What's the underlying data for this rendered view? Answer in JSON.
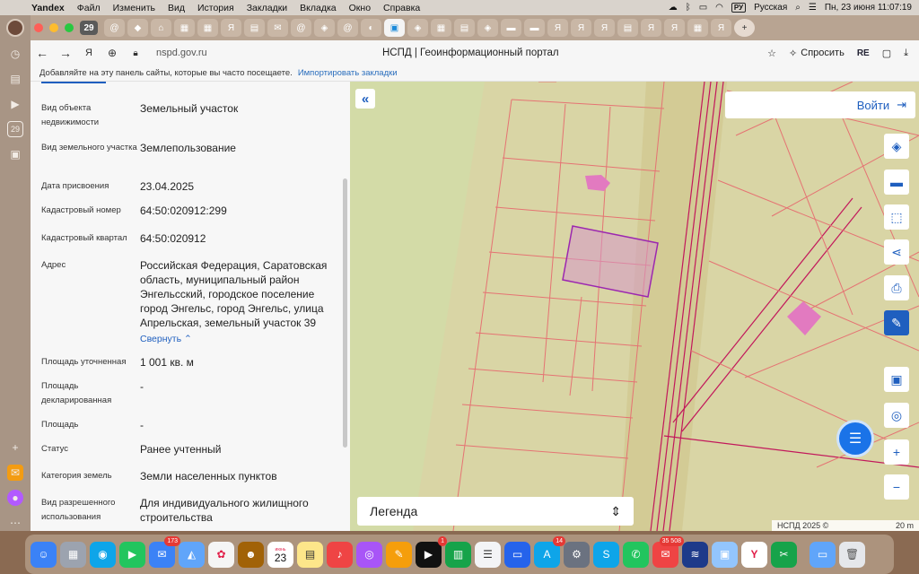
{
  "menubar": {
    "app_name": "Yandex",
    "items": [
      "Файл",
      "Изменить",
      "Вид",
      "История",
      "Закладки",
      "Вкладка",
      "Окно",
      "Справка"
    ],
    "input_source_code": "РУ",
    "input_source": "Русская",
    "clock": "Пн, 23 июня  11:07:19"
  },
  "tabs": {
    "open_count": "29"
  },
  "addressbar": {
    "url": "nspd.gov.ru",
    "page_title": "НСПД | Геоинформационный портал",
    "ask_label": "Спросить",
    "ext_label": "RE"
  },
  "bookmarks_hint": {
    "text": "Добавляйте на эту панель сайты, которые вы часто посещаете.",
    "import_link": "Импортировать закладки"
  },
  "panel": {
    "fields": [
      {
        "label": "Вид объекта недвижимости",
        "value": "Земельный участок"
      },
      {
        "label": "Вид земельного участка",
        "value": "Землепользование"
      },
      {
        "label": "Дата присвоения",
        "value": "23.04.2025"
      },
      {
        "label": "Кадастровый номер",
        "value": "64:50:020912:299"
      },
      {
        "label": "Кадастровый квартал",
        "value": "64:50:020912"
      },
      {
        "label": "Адрес",
        "value": "Российская Федерация, Саратовская область, муниципальный район Энгельсский, городское поселение город Энгельс, город Энгельс, улица Апрельская, земельный участок 39"
      },
      {
        "label": "Площадь уточненная",
        "value": "1 001 кв. м"
      },
      {
        "label": "Площадь декларированная",
        "value": "-"
      },
      {
        "label": "Площадь",
        "value": "-"
      },
      {
        "label": "Статус",
        "value": "Ранее учтенный"
      },
      {
        "label": "Категория земель",
        "value": "Земли населенных пунктов"
      },
      {
        "label": "Вид разрешенного использования",
        "value": "Для индивидуального жилищного строительства"
      }
    ],
    "collapse_label": "Свернуть"
  },
  "map": {
    "login_label": "Войти",
    "legend_label": "Легенда",
    "copyright": "НСПД 2025 ©",
    "scale_label": "20 m",
    "colors": {
      "parcel_line": "#e57373",
      "selected_parcel": "#9c27b0",
      "road_line": "#c2185b",
      "background": "#d9d5a5",
      "accent": "#1f5fbf"
    },
    "tools": [
      "layers-icon",
      "ruler-icon",
      "select-area-icon",
      "share-icon",
      "print-icon",
      "draw-icon",
      "screen-icon",
      "locate-icon",
      "zoom-in-icon",
      "zoom-out-icon"
    ],
    "zoom_in": "+",
    "zoom_out": "−"
  },
  "dock": {
    "badges": {
      "mail": "173",
      "tv": "1",
      "phone": "14",
      "notes": "35 508"
    },
    "calendar_month": "июнь",
    "calendar_day": "23"
  }
}
